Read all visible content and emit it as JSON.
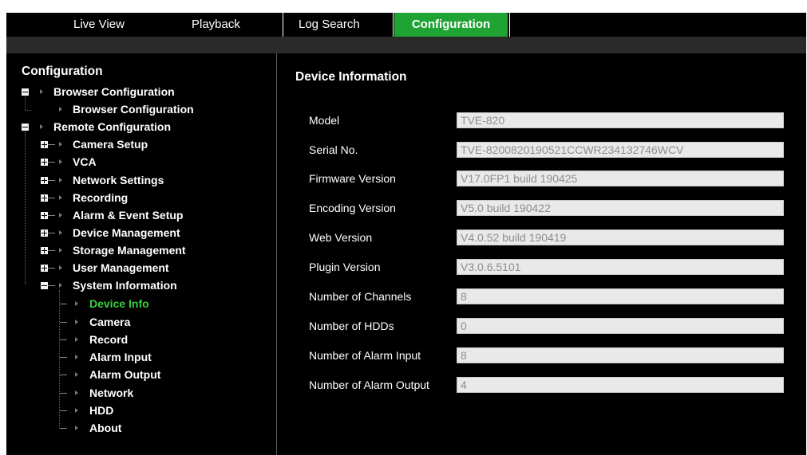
{
  "tabs": [
    {
      "label": "Live View"
    },
    {
      "label": "Playback"
    },
    {
      "label": "Log Search"
    },
    {
      "label": "Configuration"
    }
  ],
  "active_tab": "Configuration",
  "colors": {
    "accent": "#1fa333",
    "selected_text": "#35d23c"
  },
  "sidebar": {
    "title": "Configuration",
    "tree": {
      "browser_group": "Browser Configuration",
      "browser_item": "Browser Configuration",
      "remote_group": "Remote Configuration",
      "remote_items": [
        {
          "label": "Camera Setup"
        },
        {
          "label": "VCA"
        },
        {
          "label": "Network Settings"
        },
        {
          "label": "Recording"
        },
        {
          "label": "Alarm & Event Setup"
        },
        {
          "label": "Device Management"
        },
        {
          "label": "Storage Management"
        },
        {
          "label": "User Management"
        },
        {
          "label": "System Information"
        }
      ],
      "system_items": [
        {
          "label": "Device Info"
        },
        {
          "label": "Camera"
        },
        {
          "label": "Record"
        },
        {
          "label": "Alarm Input"
        },
        {
          "label": "Alarm Output"
        },
        {
          "label": "Network"
        },
        {
          "label": "HDD"
        },
        {
          "label": "About"
        }
      ],
      "selected": "Device Info"
    }
  },
  "main": {
    "title": "Device Information",
    "fields": [
      {
        "label": "Model",
        "value": "TVE-820"
      },
      {
        "label": "Serial No.",
        "value": "TVE-8200820190521CCWR234132746WCV"
      },
      {
        "label": "Firmware Version",
        "value": "V17.0FP1 build 190425"
      },
      {
        "label": "Encoding Version",
        "value": "V5.0 build 190422"
      },
      {
        "label": "Web Version",
        "value": "V4.0.52 build 190419"
      },
      {
        "label": "Plugin Version",
        "value": "V3.0.6.5101"
      },
      {
        "label": "Number of Channels",
        "value": "8"
      },
      {
        "label": "Number of HDDs",
        "value": "0"
      },
      {
        "label": "Number of Alarm Input",
        "value": "8"
      },
      {
        "label": "Number of Alarm Output",
        "value": "4"
      }
    ]
  }
}
